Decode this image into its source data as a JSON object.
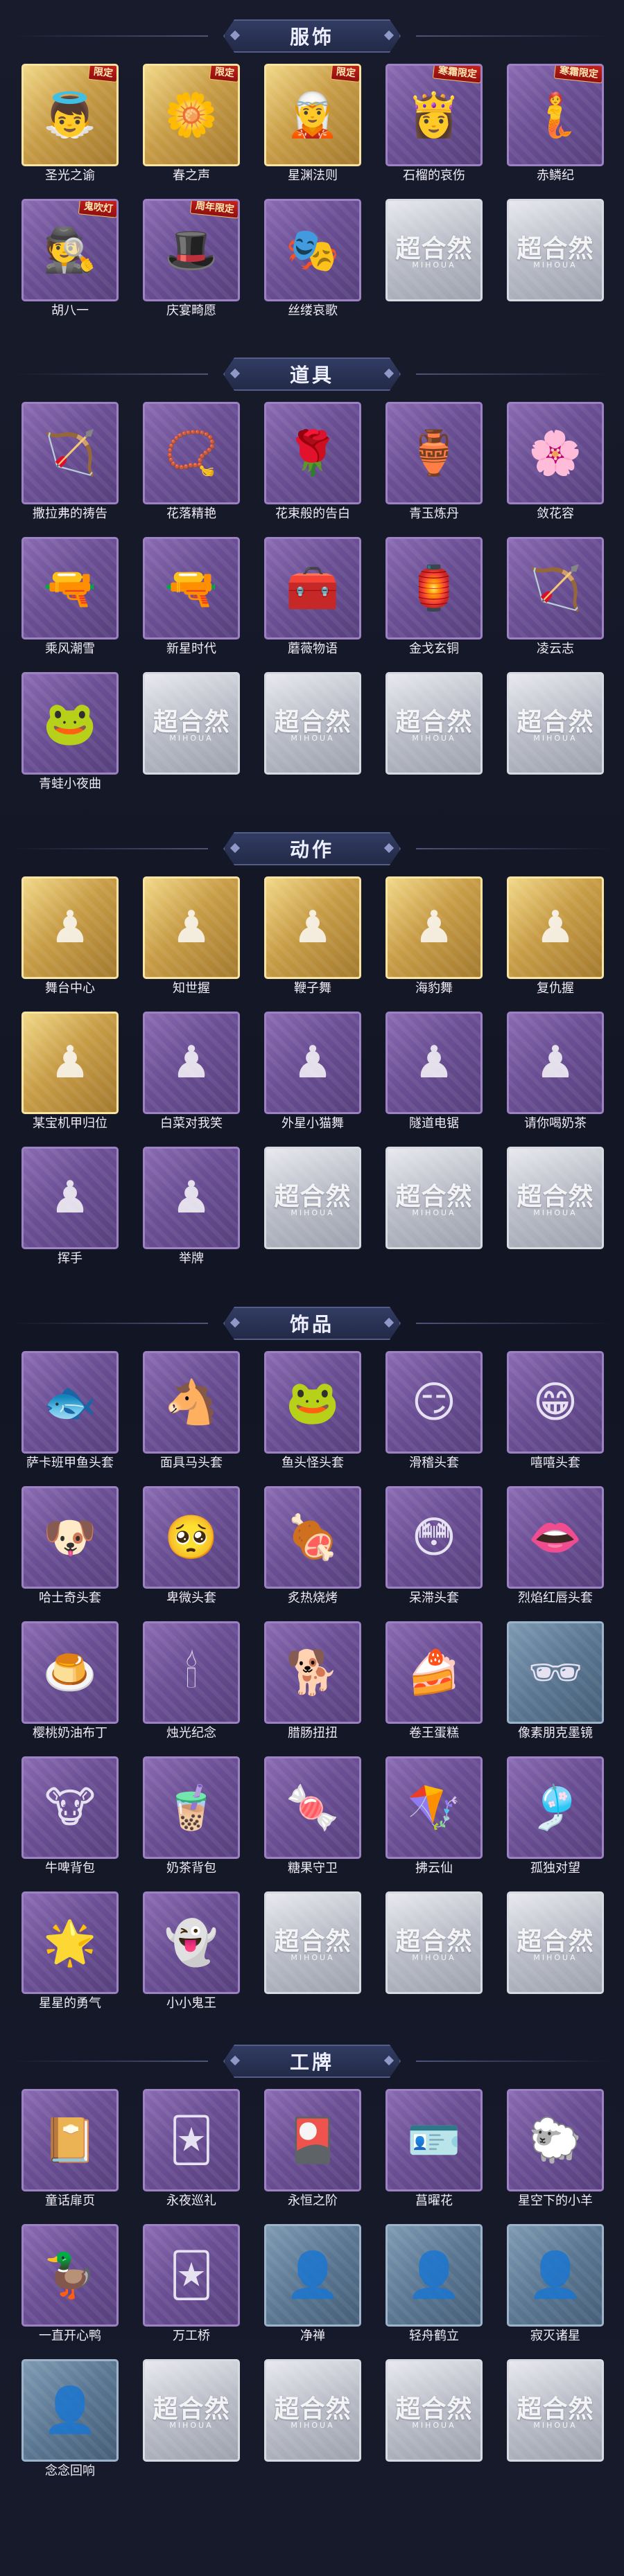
{
  "sections": [
    {
      "title": "服饰",
      "items": [
        {
          "name": "圣光之谕",
          "icon": "angel-costume-icon",
          "glyph": "👼",
          "frame": "gold",
          "tag": "限定"
        },
        {
          "name": "春之声",
          "icon": "spring-costume-icon",
          "glyph": "🌼",
          "frame": "gold",
          "tag": "限定"
        },
        {
          "name": "星渊法则",
          "icon": "star-costume-icon",
          "glyph": "🧝",
          "frame": "gold",
          "tag": "限定"
        },
        {
          "name": "石榴的哀伤",
          "icon": "pomegranate-costume-icon",
          "glyph": "👸",
          "frame": "purple",
          "tag": "寒霜限定"
        },
        {
          "name": "赤鳞纪",
          "icon": "red-scale-costume-icon",
          "glyph": "🧜",
          "frame": "purple",
          "tag": "寒霜限定"
        },
        {
          "name": "胡八一",
          "icon": "explorer-costume-icon",
          "glyph": "🕵",
          "frame": "purple",
          "tag": "鬼吹灯"
        },
        {
          "name": "庆宴畸愿",
          "icon": "banquet-costume-icon",
          "glyph": "🎩",
          "frame": "purple",
          "tag": "周年限定"
        },
        {
          "name": "丝缕哀歌",
          "icon": "thread-elegy-costume-icon",
          "glyph": "🎭",
          "frame": "purple",
          "tag": ""
        },
        {
          "name": "",
          "icon": "empty-slot-icon",
          "frame": "empty"
        },
        {
          "name": "",
          "icon": "empty-slot-icon",
          "frame": "empty"
        }
      ]
    },
    {
      "title": "道具",
      "items": [
        {
          "name": "撒拉弗的祷告",
          "icon": "angel-arrow-icon",
          "glyph": "🏹",
          "frame": "purple"
        },
        {
          "name": "花落精艳",
          "icon": "flower-necklace-icon",
          "glyph": "📿",
          "frame": "purple"
        },
        {
          "name": "花束般的告白",
          "icon": "rose-bouquet-icon",
          "glyph": "🌹",
          "frame": "purple"
        },
        {
          "name": "青玉炼丹",
          "icon": "jade-vase-icon",
          "glyph": "🏺",
          "frame": "purple"
        },
        {
          "name": "敛花容",
          "icon": "flower-garland-icon",
          "glyph": "🌸",
          "frame": "purple"
        },
        {
          "name": "乘风潮雪",
          "icon": "snow-blaster-icon",
          "glyph": "🔫",
          "frame": "purple"
        },
        {
          "name": "新星时代",
          "icon": "revolver-icon",
          "glyph": "🔫",
          "frame": "purple"
        },
        {
          "name": "蘑薇物语",
          "icon": "red-case-icon",
          "glyph": "🧰",
          "frame": "purple"
        },
        {
          "name": "金戈玄铜",
          "icon": "bronze-lantern-icon",
          "glyph": "🏮",
          "frame": "purple"
        },
        {
          "name": "凌云志",
          "icon": "crossbow-icon",
          "glyph": "🏹",
          "frame": "purple"
        },
        {
          "name": "青蛙小夜曲",
          "icon": "frog-icon",
          "glyph": "🐸",
          "frame": "purple"
        },
        {
          "name": "",
          "icon": "empty-slot-icon",
          "frame": "empty"
        },
        {
          "name": "",
          "icon": "empty-slot-icon",
          "frame": "empty"
        },
        {
          "name": "",
          "icon": "empty-slot-icon",
          "frame": "empty"
        },
        {
          "name": "",
          "icon": "empty-slot-icon",
          "frame": "empty"
        }
      ]
    },
    {
      "title": "动作",
      "items": [
        {
          "name": "舞台中心",
          "icon": "emote-pose-icon",
          "glyph": "♟",
          "frame": "gold",
          "pale": true
        },
        {
          "name": "知世握",
          "icon": "emote-pose-icon",
          "glyph": "♟",
          "frame": "gold",
          "pale": true
        },
        {
          "name": "鞭子舞",
          "icon": "emote-pose-icon",
          "glyph": "♟",
          "frame": "gold",
          "pale": true
        },
        {
          "name": "海豹舞",
          "icon": "emote-pose-icon",
          "glyph": "♟",
          "frame": "gold",
          "pale": true
        },
        {
          "name": "复仇握",
          "icon": "emote-pose-icon",
          "glyph": "♟",
          "frame": "gold",
          "pale": true
        },
        {
          "name": "某宝机甲归位",
          "icon": "emote-pose-icon",
          "glyph": "♟",
          "frame": "gold",
          "pale": true
        },
        {
          "name": "白菜对我笑",
          "icon": "emote-pose-icon",
          "glyph": "♟",
          "frame": "purple",
          "pale": true
        },
        {
          "name": "外星小猫舞",
          "icon": "emote-pose-icon",
          "glyph": "♟",
          "frame": "purple",
          "pale": true
        },
        {
          "name": "隧道电锯",
          "icon": "emote-pose-icon",
          "glyph": "♟",
          "frame": "purple",
          "pale": true
        },
        {
          "name": "请你喝奶茶",
          "icon": "emote-pose-icon",
          "glyph": "♟",
          "frame": "purple",
          "pale": true
        },
        {
          "name": "挥手",
          "icon": "emote-pose-icon",
          "glyph": "♟",
          "frame": "purple",
          "pale": true
        },
        {
          "name": "举牌",
          "icon": "emote-pose-icon",
          "glyph": "♟",
          "frame": "purple",
          "pale": true
        },
        {
          "name": "",
          "icon": "empty-slot-icon",
          "frame": "empty"
        },
        {
          "name": "",
          "icon": "empty-slot-icon",
          "frame": "empty"
        },
        {
          "name": "",
          "icon": "empty-slot-icon",
          "frame": "empty"
        }
      ]
    },
    {
      "title": "饰品",
      "items": [
        {
          "name": "萨卡班甲鱼头套",
          "icon": "fish-mask-icon",
          "glyph": "🐟",
          "frame": "purple"
        },
        {
          "name": "面具马头套",
          "icon": "horse-mask-icon",
          "glyph": "🐴",
          "frame": "purple"
        },
        {
          "name": "鱼头怪头套",
          "icon": "fish-monster-mask-icon",
          "glyph": "🐸",
          "frame": "purple"
        },
        {
          "name": "滑稽头套",
          "icon": "funny-face-mask-icon",
          "glyph": "😏",
          "frame": "purple"
        },
        {
          "name": "嘻嘻头套",
          "icon": "grin-face-mask-icon",
          "glyph": "😁",
          "frame": "purple"
        },
        {
          "name": "哈士奇头套",
          "icon": "husky-mask-icon",
          "glyph": "🐶",
          "frame": "purple"
        },
        {
          "name": "卑微头套",
          "icon": "humble-face-mask-icon",
          "glyph": "🥺",
          "frame": "purple"
        },
        {
          "name": "炙热烧烤",
          "icon": "bbq-icon",
          "glyph": "🍖",
          "frame": "purple"
        },
        {
          "name": "呆滞头套",
          "icon": "dazed-face-mask-icon",
          "glyph": "😳",
          "frame": "purple"
        },
        {
          "name": "烈焰红唇头套",
          "icon": "red-lips-mask-icon",
          "glyph": "👄",
          "frame": "purple"
        },
        {
          "name": "樱桃奶油布丁",
          "icon": "pudding-icon",
          "glyph": "🍮",
          "frame": "purple"
        },
        {
          "name": "烛光纪念",
          "icon": "candle-icon",
          "glyph": "🕯",
          "frame": "purple"
        },
        {
          "name": "腊肠扭扭",
          "icon": "sausage-dog-icon",
          "glyph": "🐕",
          "frame": "purple"
        },
        {
          "name": "卷王蛋糕",
          "icon": "roll-cake-icon",
          "glyph": "🍰",
          "frame": "purple"
        },
        {
          "name": "像素朋克墨镜",
          "icon": "pixel-glasses-icon",
          "glyph": "🕶",
          "frame": "blue"
        },
        {
          "name": "牛啤背包",
          "icon": "cow-backpack-icon",
          "glyph": "🐮",
          "frame": "purple"
        },
        {
          "name": "奶茶背包",
          "icon": "milk-tea-backpack-icon",
          "glyph": "🧋",
          "frame": "purple"
        },
        {
          "name": "糖果守卫",
          "icon": "candy-guard-icon",
          "glyph": "🍬",
          "frame": "purple"
        },
        {
          "name": "拂云仙",
          "icon": "cloud-fairy-icon",
          "glyph": "🪁",
          "frame": "purple"
        },
        {
          "name": "孤独对望",
          "icon": "lonely-gaze-icon",
          "glyph": "🎐",
          "frame": "purple"
        },
        {
          "name": "星星的勇气",
          "icon": "star-courage-icon",
          "glyph": "🌟",
          "frame": "purple"
        },
        {
          "name": "小小鬼王",
          "icon": "little-ghost-king-icon",
          "glyph": "👻",
          "frame": "purple"
        },
        {
          "name": "",
          "icon": "empty-slot-icon",
          "frame": "empty"
        },
        {
          "name": "",
          "icon": "empty-slot-icon",
          "frame": "empty"
        },
        {
          "name": "",
          "icon": "empty-slot-icon",
          "frame": "empty"
        }
      ]
    },
    {
      "title": "工牌",
      "items": [
        {
          "name": "童话扉页",
          "icon": "fairy-tale-card-icon",
          "glyph": "📔",
          "frame": "purple"
        },
        {
          "name": "永夜巡礼",
          "icon": "night-card-icon",
          "glyph": "🃏",
          "frame": "purple"
        },
        {
          "name": "永恒之阶",
          "icon": "eternal-card-icon",
          "glyph": "🎴",
          "frame": "purple"
        },
        {
          "name": "菖曜花",
          "icon": "flower-card-icon",
          "glyph": "🪪",
          "frame": "purple"
        },
        {
          "name": "星空下的小羊",
          "icon": "sheep-card-icon",
          "glyph": "🐑",
          "frame": "purple"
        },
        {
          "name": "一直开心鸭",
          "icon": "duck-card-icon",
          "glyph": "🦆",
          "frame": "purple"
        },
        {
          "name": "万工桥",
          "icon": "bridge-card-icon",
          "glyph": "🃏",
          "frame": "purple"
        },
        {
          "name": "净禅",
          "icon": "silhouette-card-icon",
          "glyph": "👤",
          "frame": "blue",
          "pale": true
        },
        {
          "name": "轻舟鹤立",
          "icon": "silhouette-card-icon",
          "glyph": "👤",
          "frame": "blue",
          "pale": true
        },
        {
          "name": "寂灭诸星",
          "icon": "silhouette-card-icon",
          "glyph": "👤",
          "frame": "blue",
          "pale": true
        },
        {
          "name": "念念回响",
          "icon": "silhouette-card-icon",
          "glyph": "👤",
          "frame": "blue",
          "pale": true
        },
        {
          "name": "",
          "icon": "empty-slot-icon",
          "frame": "empty"
        },
        {
          "name": "",
          "icon": "empty-slot-icon",
          "frame": "empty"
        },
        {
          "name": "",
          "icon": "empty-slot-icon",
          "frame": "empty"
        },
        {
          "name": "",
          "icon": "empty-slot-icon",
          "frame": "empty"
        }
      ]
    }
  ],
  "empty_slot": {
    "logo": "超合然",
    "sub": "MIHOUA"
  }
}
